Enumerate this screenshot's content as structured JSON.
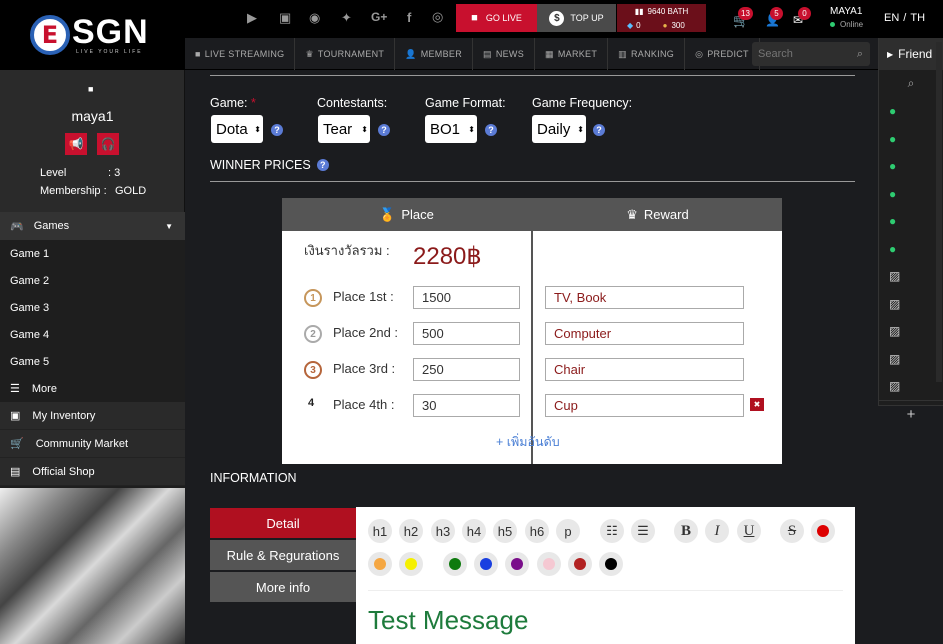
{
  "brand": {
    "logo_letter": "E",
    "name": "SGN",
    "tagline": "LIVE YOUR LIFE"
  },
  "profile": {
    "status_dot": "■",
    "username": "maya1",
    "level_label": "Level",
    "level_value": ": 3",
    "membership_label": "Membership :",
    "membership_value": "GOLD"
  },
  "sidebar": {
    "games_label": "Games",
    "games": [
      "Game 1",
      "Game 2",
      "Game 3",
      "Game 4",
      "Game 5"
    ],
    "more_label": "More",
    "inventory": "My Inventory",
    "community": "Community Market",
    "shop": "Official Shop"
  },
  "topbar": {
    "go_live": "GO LIVE",
    "top_up": "TOP UP",
    "balance": "9640 BATH",
    "diamonds": "0",
    "coins": "300",
    "cart_count": "13",
    "friend_req_count": "5",
    "messages_count": "0",
    "user_name": "MAYA1",
    "user_status": "Online",
    "lang_en": "EN",
    "lang_sep": "/",
    "lang_th": "TH"
  },
  "nav": {
    "items": [
      "LIVE STREAMING",
      "TOURNAMENT",
      "MEMBER",
      "NEWS",
      "MARKET",
      "RANKING",
      "PREDICT"
    ],
    "search_placeholder": "Search"
  },
  "friends": {
    "title": "Friend",
    "add": "+"
  },
  "form": {
    "game_label": "Game:",
    "required_mark": "*",
    "game_value": "Dota",
    "contestants_label": "Contestants:",
    "contestants_value": "Tear",
    "format_label": "Game Format:",
    "format_value": "BO1",
    "frequency_label": "Game Frequency:",
    "frequency_value": "Daily",
    "help_glyph": "?"
  },
  "winner": {
    "section_title": "WINNER PRICES",
    "place_header": "Place",
    "reward_header": "Reward",
    "total_label": "เงินรางวัลรวม :",
    "total_value": "2280฿",
    "places": [
      {
        "badge": "1",
        "label": "Place 1st :",
        "amount": "1500",
        "reward": "TV, Book"
      },
      {
        "badge": "2",
        "label": "Place 2nd :",
        "amount": "500",
        "reward": "Computer"
      },
      {
        "badge": "3",
        "label": "Place 3rd :",
        "amount": "250",
        "reward": "Chair"
      },
      {
        "badge": "4",
        "label": "Place 4th :",
        "amount": "30",
        "reward": "Cup"
      }
    ],
    "add_rank": "+ เพิ่มอันดับ",
    "remove_glyph": "✖"
  },
  "information": {
    "title": "INFORMATION",
    "tabs": [
      "Detail",
      "Rule & Regurations",
      "More info"
    ],
    "toolbar": [
      "h1",
      "h2",
      "h3",
      "h4",
      "h5",
      "h6",
      "p"
    ],
    "list_ol": "☷",
    "list_ul": "☰",
    "bold": "B",
    "italic": "I",
    "underline": "U",
    "strike": "S",
    "palette": [
      "#dd0000",
      "#f5a742",
      "#f5f000",
      "#0e7a0e",
      "#1a3fe0",
      "#7a0e8a",
      "#f5c8d2",
      "#b22222",
      "#000000"
    ],
    "message": "Test Message"
  },
  "colors": {
    "accent": "#c8102e",
    "message": "#1e7b3c",
    "help": "#5b7bd5"
  }
}
